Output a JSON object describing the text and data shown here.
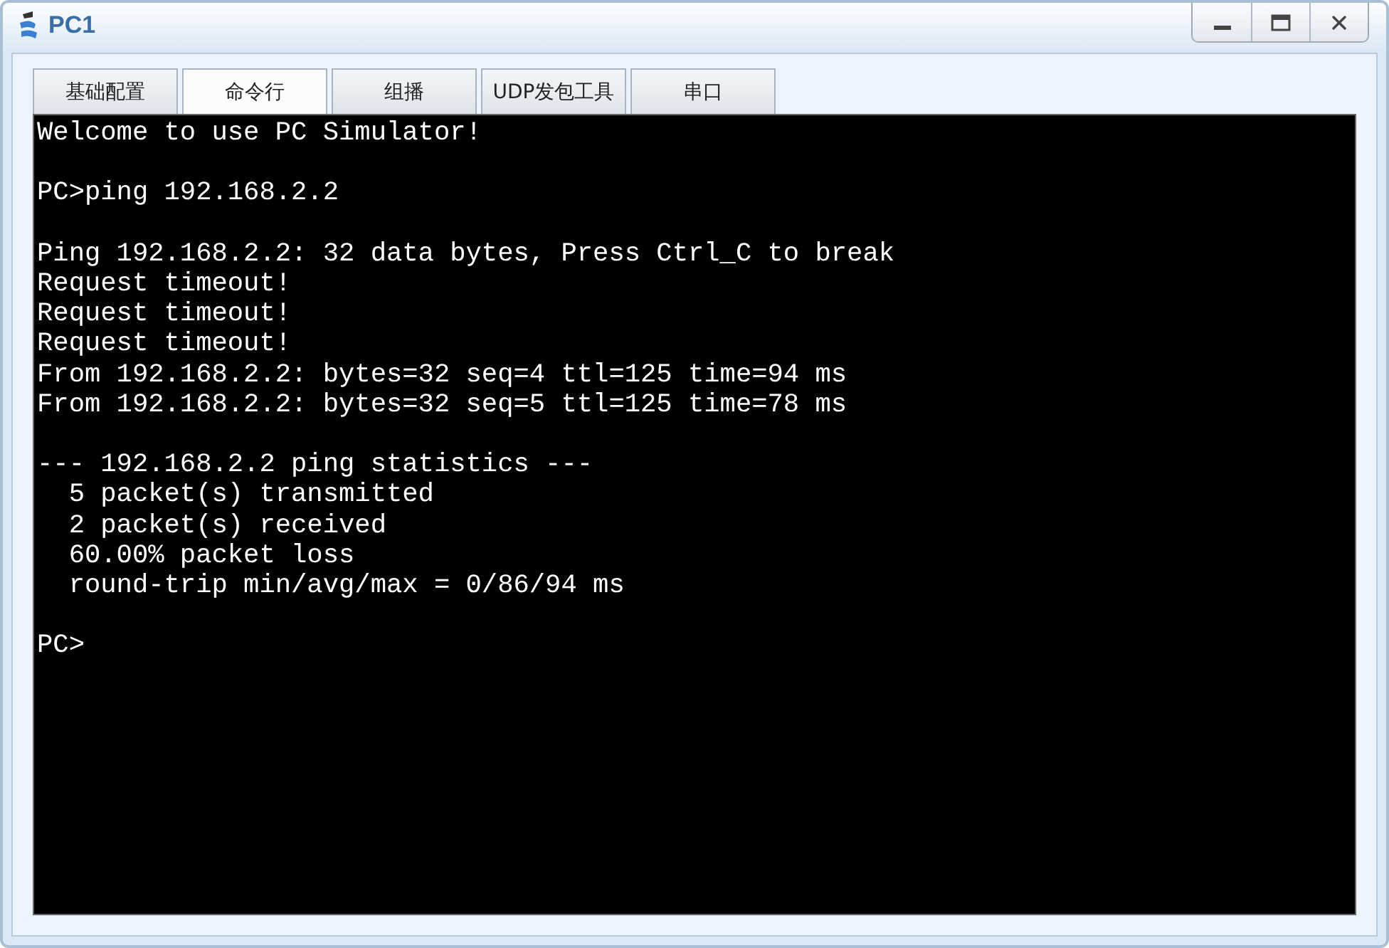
{
  "window": {
    "title": "PC1"
  },
  "tabs": [
    {
      "label": "基础配置",
      "selected": false
    },
    {
      "label": "命令行",
      "selected": true
    },
    {
      "label": "组播",
      "selected": false
    },
    {
      "label": "UDP发包工具",
      "selected": false
    },
    {
      "label": "串口",
      "selected": false
    }
  ],
  "terminal": {
    "blocks": [
      [
        "Welcome to use PC Simulator!"
      ],
      [
        "PC>ping 192.168.2.2"
      ],
      [
        "Ping 192.168.2.2: 32 data bytes, Press Ctrl_C to break",
        "Request timeout!",
        "Request timeout!",
        "Request timeout!",
        "From 192.168.2.2: bytes=32 seq=4 ttl=125 time=94 ms",
        "From 192.168.2.2: bytes=32 seq=5 ttl=125 time=78 ms"
      ],
      [
        "--- 192.168.2.2 ping statistics ---",
        "  5 packet(s) transmitted",
        "  2 packet(s) received",
        "  60.00% packet loss",
        "  round-trip min/avg/max = 0/86/94 ms"
      ],
      [
        "PC>"
      ]
    ]
  }
}
